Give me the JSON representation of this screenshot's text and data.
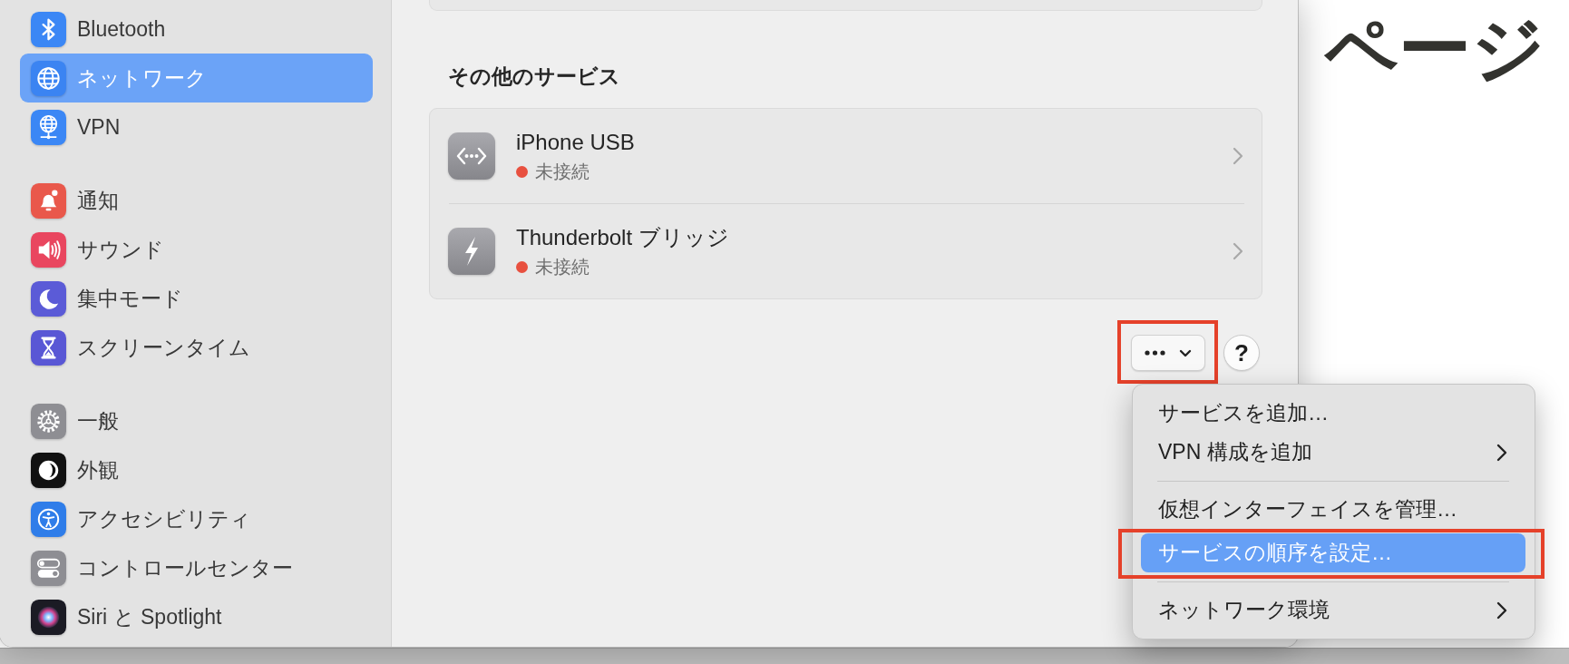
{
  "sidebar": {
    "groups": [
      {
        "items": [
          {
            "label": "Bluetooth",
            "selected": false
          },
          {
            "label": "ネットワーク",
            "selected": true
          },
          {
            "label": "VPN",
            "selected": false
          }
        ]
      },
      {
        "items": [
          {
            "label": "通知",
            "selected": false
          },
          {
            "label": "サウンド",
            "selected": false
          },
          {
            "label": "集中モード",
            "selected": false
          },
          {
            "label": "スクリーンタイム",
            "selected": false
          }
        ]
      },
      {
        "items": [
          {
            "label": "一般",
            "selected": false
          },
          {
            "label": "外観",
            "selected": false
          },
          {
            "label": "アクセシビリティ",
            "selected": false
          },
          {
            "label": "コントロールセンター",
            "selected": false
          },
          {
            "label": "Siri と Spotlight",
            "selected": false
          }
        ]
      }
    ]
  },
  "other_services": {
    "heading": "その他のサービス",
    "items": [
      {
        "name": "iPhone USB",
        "status": "未接続",
        "color": "#e8503f"
      },
      {
        "name": "Thunderbolt ブリッジ",
        "status": "未接続",
        "color": "#e8503f"
      }
    ]
  },
  "toolbar": {
    "more_button": {
      "annotated": true
    },
    "help_button": {
      "label": "?"
    }
  },
  "menu": {
    "sections": [
      {
        "items": [
          {
            "label": "サービスを追加…",
            "submenu": false,
            "selected": false,
            "annotated": false
          },
          {
            "label": "VPN 構成を追加",
            "submenu": true,
            "selected": false,
            "annotated": false
          }
        ]
      },
      {
        "items": [
          {
            "label": "仮想インターフェイスを管理…",
            "submenu": false,
            "selected": false,
            "annotated": false
          },
          {
            "label": "サービスの順序を設定…",
            "submenu": false,
            "selected": true,
            "annotated": true
          }
        ]
      },
      {
        "items": [
          {
            "label": "ネットワーク環境",
            "submenu": true,
            "selected": false,
            "annotated": false
          }
        ]
      }
    ]
  },
  "background_page": {
    "heading": "ページ"
  }
}
